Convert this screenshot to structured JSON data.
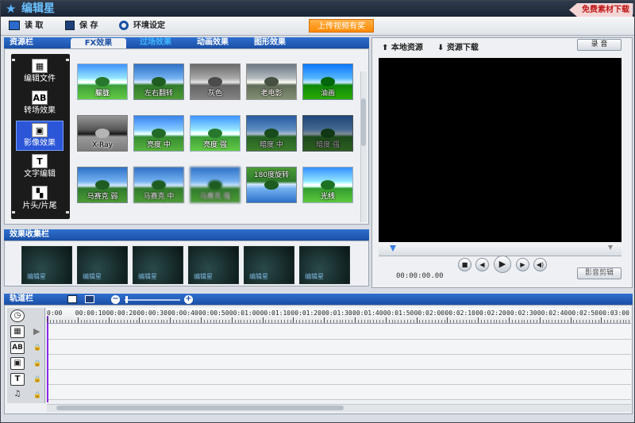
{
  "app": {
    "title": "编辑星",
    "logo_icon": "star-icon"
  },
  "window_buttons": [
    "?",
    "_",
    "X"
  ],
  "toolbar": {
    "read_label": "读 取",
    "save_label": "保 存",
    "settings_label": "环境设定",
    "upload_badge": "上传视频有奖",
    "free_download": "免费素材下载"
  },
  "resource_panel": {
    "header": "资源栏",
    "tabs": [
      "FX效果",
      "过场效果",
      "动画效果",
      "图形效果"
    ],
    "active_tab": "FX效果",
    "side_items": [
      {
        "label": "编辑文件",
        "icon": "film-icon",
        "glyph": "▦"
      },
      {
        "label": "转场效果",
        "icon": "transition-ab-icon",
        "glyph": "AB"
      },
      {
        "label": "影像效果",
        "icon": "video-effect-icon",
        "glyph": "▣"
      },
      {
        "label": "文字编辑",
        "icon": "text-icon",
        "glyph": "T"
      },
      {
        "label": "片头/片尾",
        "icon": "intro-outro-icon",
        "glyph": "▚"
      }
    ],
    "active_side": "影像效果",
    "effects": [
      [
        "朦胧",
        "左右翻转",
        "灰色",
        "老电影",
        "油画"
      ],
      [
        "X-Ray",
        "亮度 中",
        "亮度 强",
        "暗度 中",
        "暗度 强"
      ],
      [
        "马赛克 弱",
        "马赛克 中",
        "马赛克 强",
        "180度旋转",
        "光线"
      ]
    ]
  },
  "collection_panel": {
    "header": "效果收集栏",
    "slot_label": "编辑星",
    "slot_count": 6
  },
  "preview_panel": {
    "local_resources": "本地资源",
    "resource_download": "资源下载",
    "record_button": "录 音",
    "timecode": "00:00:00.00",
    "edit_button": "影音剪辑",
    "controls": [
      "stop",
      "prev",
      "play",
      "next",
      "volume"
    ]
  },
  "track_panel": {
    "header": "轨道栏",
    "ruler_ticks": [
      "0:00",
      "00:00:10",
      "00:00:20",
      "00:00:30",
      "00:00:40",
      "00:00:50",
      "00:01:00",
      "00:01:10",
      "00:01:20",
      "00:01:30",
      "00:01:40",
      "00:01:50",
      "00:02:00",
      "00:02:10",
      "00:02:20",
      "00:02:30",
      "00:02:40",
      "00:02:50",
      "00:03:00"
    ],
    "tracks": [
      {
        "name": "video",
        "glyph": "▦"
      },
      {
        "name": "transition",
        "glyph": "AB"
      },
      {
        "name": "effect",
        "glyph": "▣"
      },
      {
        "name": "text",
        "glyph": "T"
      },
      {
        "name": "audio",
        "glyph": "♫"
      }
    ]
  },
  "colors": {
    "panel_header": "#1a4fa5",
    "upload_badge": "#ff8a00",
    "free_download_text": "#c01818",
    "playhead": "#8a2be2"
  }
}
